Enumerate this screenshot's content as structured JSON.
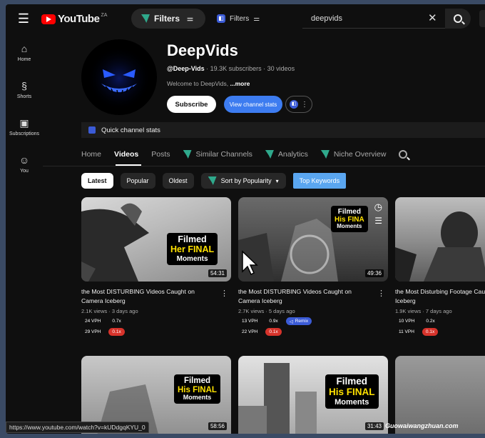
{
  "app": {
    "logo_text": "YouTube",
    "logo_suffix": "ZA"
  },
  "topbar": {
    "filters_label": "Filters",
    "filters_small_label": "Filters",
    "search_value": "deepvids"
  },
  "sidebar": {
    "items": [
      {
        "label": "Home",
        "icon": "home-icon"
      },
      {
        "label": "Shorts",
        "icon": "shorts-icon"
      },
      {
        "label": "Subscriptions",
        "icon": "subscriptions-icon"
      },
      {
        "label": "You",
        "icon": "you-icon"
      }
    ]
  },
  "channel": {
    "name": "DeepVids",
    "handle": "@Deep-Vids",
    "meta": " · 19.3K subscribers · 30 videos",
    "description": "Welcome to DeepVids, ",
    "description_more": "...more",
    "subscribe_label": "Subscribe",
    "view_stats_label": "View channel stats",
    "quick_stats_label": "Quick channel stats"
  },
  "tabs": [
    {
      "label": "Home"
    },
    {
      "label": "Videos"
    },
    {
      "label": "Posts"
    },
    {
      "label": "Similar Channels"
    },
    {
      "label": "Analytics"
    },
    {
      "label": "Niche Overview"
    }
  ],
  "chips": {
    "latest": "Latest",
    "popular": "Popular",
    "oldest": "Oldest",
    "sort": "Sort by Popularity",
    "keywords": "Top Keywords"
  },
  "videos": [
    {
      "badge_top": "Filmed",
      "badge_mid": "Her FINAL",
      "badge_bot": "Moments",
      "duration": "54:31",
      "title": "the Most DISTURBING Videos Caught on Camera Iceberg",
      "meta": "2.1K views · 3 days ago",
      "vph1": "24 VPH",
      "ratio1": "0.7x",
      "vph2": "29 VPH",
      "ratio2": "0.1x"
    },
    {
      "badge_top": "Filmed",
      "badge_mid": "His FINA",
      "badge_bot": "Moments",
      "duration": "49:36",
      "title": "the Most DISTURBING Videos Caught on Camera Iceberg",
      "meta": "2.7K views · 5 days ago",
      "vph1": "13 VPH",
      "ratio1": "0.9x",
      "remix": "Remix",
      "vph2": "22 VPH",
      "ratio2": "0.1x"
    },
    {
      "title": "the Most Disturbing Footage Caught on Camera Iceberg",
      "meta": "1.9K views · 7 days ago",
      "vph1": "10 VPH",
      "ratio1": "0.2x",
      "vph2": "11 VPH",
      "ratio2": "0.1x"
    },
    {
      "badge_top": "Filmed",
      "badge_mid": "His FINAL",
      "badge_bot": "Moments",
      "duration": "58:56"
    },
    {
      "badge_top": "Filmed",
      "badge_mid": "His FINAL",
      "badge_bot": "Moments",
      "duration": "31:43"
    }
  ],
  "status_url": "https://www.youtube.com/watch?v=kUDdgqKYU_0",
  "watermark": "Guowaiwangzhuan.com"
}
